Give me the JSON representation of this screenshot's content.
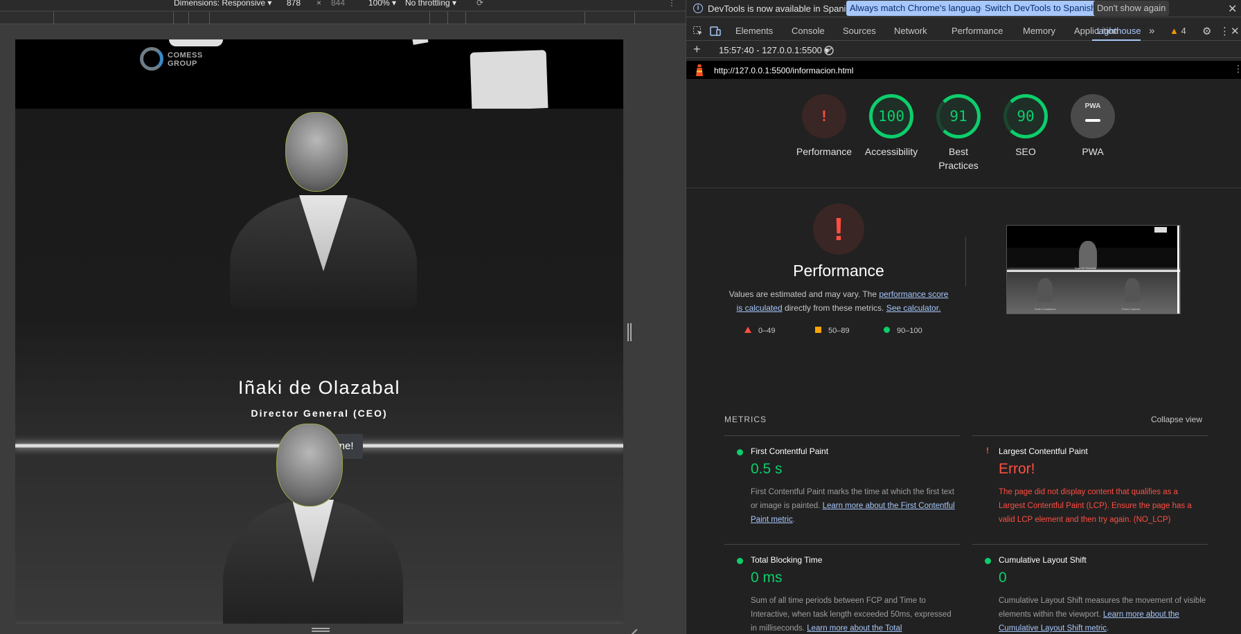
{
  "emulation": {
    "dimensions_label": "Dimensions: Responsive",
    "width": "878",
    "times": "×",
    "height": "844",
    "zoom": "100%",
    "throttling": "No throttling"
  },
  "site": {
    "logo_line1": "COMESS",
    "logo_line2": "GROUP",
    "person_name": "Iñaki de Olazabal",
    "person_role": "Director General (CEO)",
    "read_button": "¡Léeme!"
  },
  "devtools": {
    "info_message": "DevTools is now available in Spanish!",
    "btn_match_language": "Always match Chrome's language",
    "btn_switch_spanish": "Switch DevTools to Spanish",
    "btn_dont_show": "Don't show again",
    "tabs": [
      "Elements",
      "Console",
      "Sources",
      "Network",
      "Performance",
      "Memory",
      "Application",
      "Lighthouse"
    ],
    "active_tab": "Lighthouse",
    "warning_count": "4",
    "report_selector": "15:57:40 - 127.0.0.1:5500",
    "url": "http://127.0.0.1:5500/informacion.html"
  },
  "lighthouse": {
    "gauges": {
      "performance": {
        "label": "Performance",
        "value": "!"
      },
      "accessibility": {
        "label": "Accessibility",
        "value": "100"
      },
      "best_practices": {
        "label": "Best Practices",
        "value": "91"
      },
      "seo": {
        "label": "SEO",
        "value": "90"
      },
      "pwa": {
        "label": "PWA",
        "value": "PWA"
      }
    },
    "perf_title": "Performance",
    "perf_desc_prefix": "Values are estimated and may vary. The",
    "perf_desc_link1": "performance score is calculated",
    "perf_desc_middle": "directly from these metrics.",
    "perf_desc_link2": "See calculator.",
    "legend": {
      "fail": "0–49",
      "average": "50–89",
      "pass": "90–100"
    },
    "metrics_title": "METRICS",
    "collapse_view": "Collapse view",
    "metrics": {
      "fcp": {
        "name": "First Contentful Paint",
        "value": "0.5 s",
        "desc": "First Contentful Paint marks the time at which the first text or image is painted.",
        "link": "Learn more about the First Contentful Paint metric"
      },
      "lcp": {
        "name": "Largest Contentful Paint",
        "value": "Error!",
        "desc": "The page did not display content that qualifies as a Largest Contentful Paint (LCP). Ensure the page has a valid LCP element and then try again. (NO_LCP)"
      },
      "tbt": {
        "name": "Total Blocking Time",
        "value": "0 ms",
        "desc": "Sum of all time periods between FCP and Time to Interactive, when task length exceeded 50ms, expressed in milliseconds.",
        "link": "Learn more about the Total"
      },
      "cls": {
        "name": "Cumulative Layout Shift",
        "value": "0",
        "desc": "Cumulative Layout Shift measures the movement of visible elements within the viewport.",
        "link": "Learn more about the Cumulative Layout Shift metric"
      }
    },
    "thumb_captions": {
      "top_name": "Iñaki de Olazabal",
      "left": "Pedro Castellano",
      "right": "Pedro Cabrera"
    }
  },
  "colors": {
    "pass": "#0cce6b",
    "fail": "#ff4e42",
    "average": "#ffa400",
    "accent": "#a8c7fa"
  }
}
